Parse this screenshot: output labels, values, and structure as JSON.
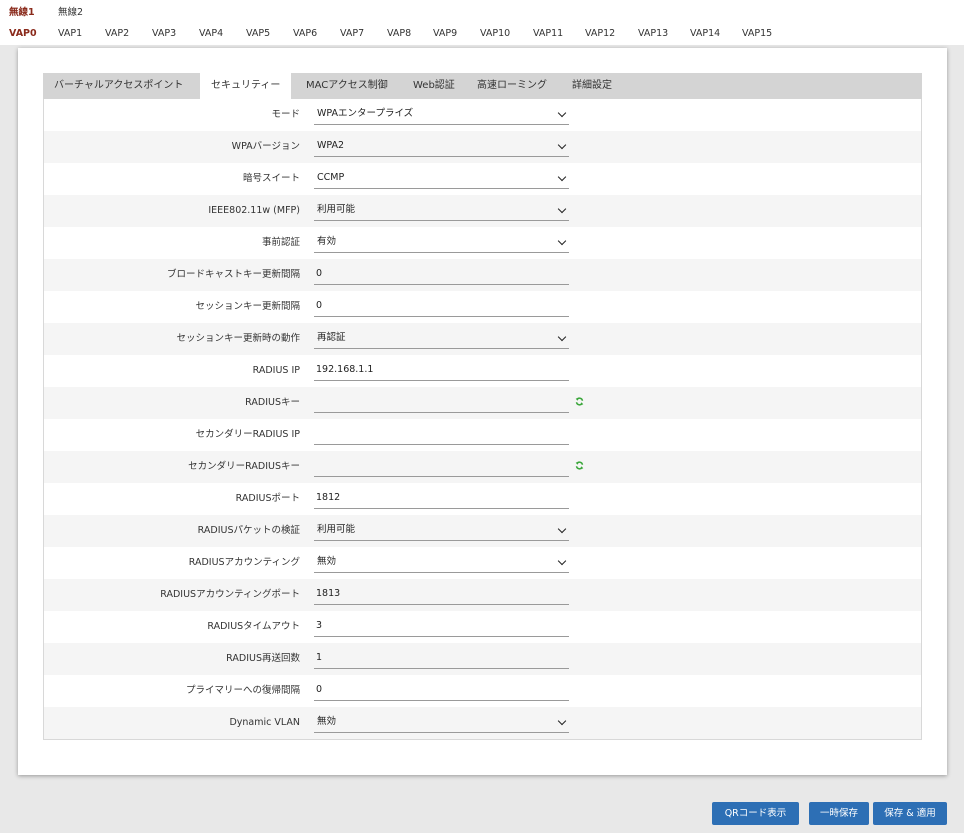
{
  "radio_tabs": [
    {
      "label": "無線1",
      "active": true
    },
    {
      "label": "無線2",
      "active": false
    }
  ],
  "vap_tabs": [
    {
      "label": "VAP0",
      "active": true
    },
    {
      "label": "VAP1"
    },
    {
      "label": "VAP2"
    },
    {
      "label": "VAP3"
    },
    {
      "label": "VAP4"
    },
    {
      "label": "VAP5"
    },
    {
      "label": "VAP6"
    },
    {
      "label": "VAP7"
    },
    {
      "label": "VAP8"
    },
    {
      "label": "VAP9"
    },
    {
      "label": "VAP10"
    },
    {
      "label": "VAP11"
    },
    {
      "label": "VAP12"
    },
    {
      "label": "VAP13"
    },
    {
      "label": "VAP14"
    },
    {
      "label": "VAP15"
    }
  ],
  "sub_tabs": [
    {
      "label": "バーチャルアクセスポイント"
    },
    {
      "label": "セキュリティー",
      "active": true
    },
    {
      "label": "MACアクセス制御"
    },
    {
      "label": "Web認証"
    },
    {
      "label": "高速ローミング"
    },
    {
      "label": "詳細設定"
    }
  ],
  "form": {
    "rows": [
      {
        "label": "モード",
        "value": "WPAエンタープライズ",
        "type": "select"
      },
      {
        "label": "WPAバージョン",
        "value": "WPA2",
        "type": "select"
      },
      {
        "label": "暗号スイート",
        "value": "CCMP",
        "type": "select"
      },
      {
        "label": "IEEE802.11w (MFP)",
        "value": "利用可能",
        "type": "select"
      },
      {
        "label": "事前認証",
        "value": "有効",
        "type": "select"
      },
      {
        "label": "ブロードキャストキー更新間隔",
        "value": "0",
        "type": "text"
      },
      {
        "label": "セッションキー更新間隔",
        "value": "0",
        "type": "text"
      },
      {
        "label": "セッションキー更新時の動作",
        "value": "再認証",
        "type": "select"
      },
      {
        "label": "RADIUS IP",
        "value": "192.168.1.1",
        "type": "text"
      },
      {
        "label": "RADIUSキー",
        "value": "",
        "type": "password"
      },
      {
        "label": "セカンダリーRADIUS IP",
        "value": "",
        "type": "text"
      },
      {
        "label": "セカンダリーRADIUSキー",
        "value": "",
        "type": "password"
      },
      {
        "label": "RADIUSポート",
        "value": "1812",
        "type": "text"
      },
      {
        "label": "RADIUSパケットの検証",
        "value": "利用可能",
        "type": "select"
      },
      {
        "label": "RADIUSアカウンティング",
        "value": "無効",
        "type": "select"
      },
      {
        "label": "RADIUSアカウンティングポート",
        "value": "1813",
        "type": "text"
      },
      {
        "label": "RADIUSタイムアウト",
        "value": "3",
        "type": "text"
      },
      {
        "label": "RADIUS再送回数",
        "value": "1",
        "type": "text"
      },
      {
        "label": "プライマリーへの復帰間隔",
        "value": "0",
        "type": "text"
      },
      {
        "label": "Dynamic VLAN",
        "value": "無効",
        "type": "select"
      }
    ]
  },
  "buttons": {
    "qr": "QRコード表示",
    "temp_save": "一時保存",
    "save_apply": "保存 & 適用"
  },
  "icons": {
    "select_arrow": "chevron-down-icon",
    "key_regenerate": "refresh-icon"
  },
  "colors": {
    "active_tab": "#8a2a1b",
    "button": "#2d6fb5",
    "refresh_icon": "#3aa63a"
  }
}
